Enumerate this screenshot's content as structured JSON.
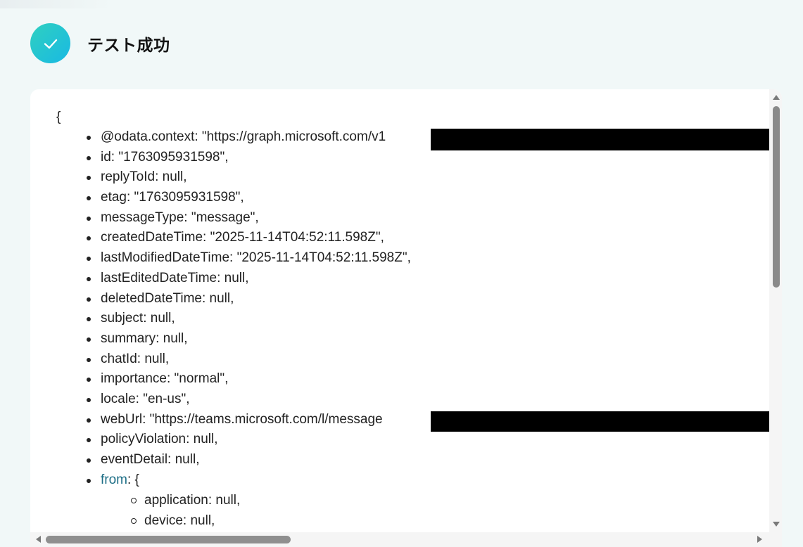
{
  "header": {
    "title": "テスト成功",
    "icon": "check-icon"
  },
  "colors": {
    "success_gradient_start": "#2fd0c0",
    "success_gradient_end": "#19b9e3",
    "background": "#f1f8f8",
    "link_key": "#1d6e86"
  },
  "json_view": {
    "open_brace": "{",
    "items": [
      "@odata.context: \"https://graph.microsoft.com/v1",
      "id: \"1763095931598\",",
      "replyToId: null,",
      "etag: \"1763095931598\",",
      "messageType: \"message\",",
      "createdDateTime: \"2025-11-14T04:52:11.598Z\",",
      "lastModifiedDateTime: \"2025-11-14T04:52:11.598Z\",",
      "lastEditedDateTime: null,",
      "deletedDateTime: null,",
      "subject: null,",
      "summary: null,",
      "chatId: null,",
      "importance: \"normal\",",
      "locale: \"en-us\",",
      "webUrl: \"https://teams.microsoft.com/l/message",
      "policyViolation: null,",
      "eventDetail: null,"
    ],
    "from_key": "from",
    "from_suffix": ": {",
    "from_children": [
      "application: null,",
      "device: null,"
    ]
  }
}
